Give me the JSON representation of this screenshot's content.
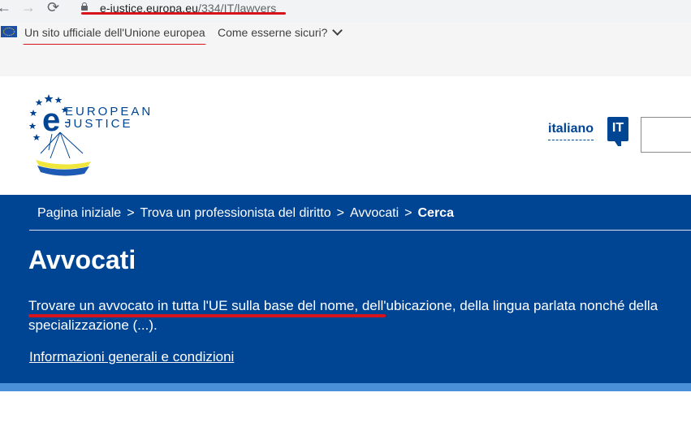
{
  "browser": {
    "back_icon": "←",
    "forward_icon": "→",
    "reload_icon": "⟳",
    "url_host": "e-justice.europa.eu",
    "url_path": "/334/IT/lawyers",
    "accent": "#d7141b"
  },
  "eu_banner": {
    "official_text": "Un sito ufficiale dell'Unione europea",
    "how_to_check": "Come esserne sicuri?"
  },
  "header": {
    "logo_text_line1": "EUROPEAN",
    "logo_text_line2": "JUSTICE",
    "logo_letter": "e",
    "language_label": "italiano",
    "language_code": "IT"
  },
  "breadcrumb": {
    "items": [
      "Pagina iniziale",
      "Trova un professionista del diritto",
      "Avvocati",
      "Cerca"
    ],
    "separator": ">"
  },
  "page": {
    "title": "Avvocati",
    "intro": "Trovare un avvocato in tutta l'UE sulla base del nome, dell'ubicazione, della lingua parlata nonché della specializzazione (...).",
    "info_link": "Informazioni generali e condizioni",
    "brand_color": "#004494"
  }
}
